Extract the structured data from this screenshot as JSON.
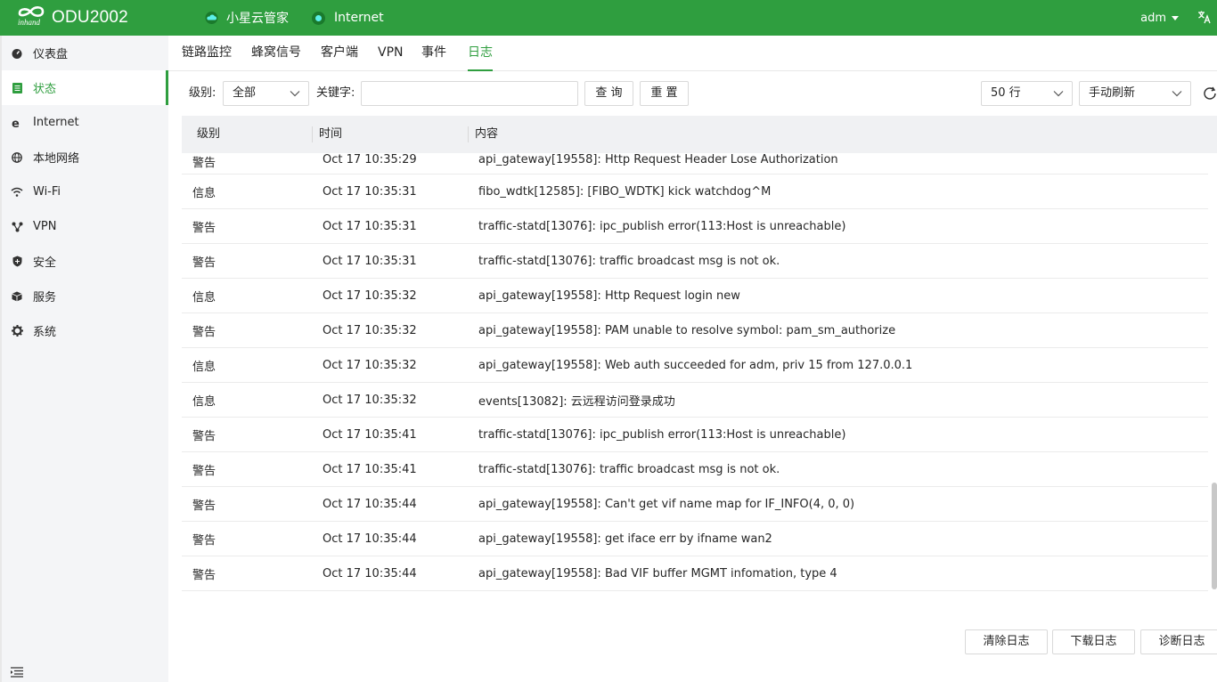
{
  "header": {
    "logo_text": "inhand",
    "model": "ODU2002",
    "cloud_label": "小星云管家",
    "internet_label": "Internet",
    "user": "adm",
    "lang_glyph": "文A"
  },
  "sidebar": {
    "items": [
      {
        "label": "仪表盘",
        "icon": "dashboard-icon"
      },
      {
        "label": "状态",
        "icon": "status-icon"
      },
      {
        "label": "Internet",
        "icon": "internet-icon"
      },
      {
        "label": "本地网络",
        "icon": "globe-icon"
      },
      {
        "label": "Wi-Fi",
        "icon": "wifi-icon"
      },
      {
        "label": "VPN",
        "icon": "vpn-icon"
      },
      {
        "label": "安全",
        "icon": "shield-icon"
      },
      {
        "label": "服务",
        "icon": "cube-icon"
      },
      {
        "label": "系统",
        "icon": "gear-icon"
      }
    ],
    "active_index": 1
  },
  "tabs": [
    {
      "label": "链路监控"
    },
    {
      "label": "蜂窝信号"
    },
    {
      "label": "客户端"
    },
    {
      "label": "VPN"
    },
    {
      "label": "事件"
    },
    {
      "label": "日志"
    }
  ],
  "active_tab": 5,
  "toolbar": {
    "level_label": "级别:",
    "level_value": "全部",
    "keyword_label": "关键字:",
    "keyword_value": "",
    "query_btn": "查 询",
    "reset_btn": "重 置",
    "rows_value": "50 行",
    "refresh_mode": "手动刷新"
  },
  "table": {
    "columns": [
      "级别",
      "时间",
      "内容"
    ],
    "rows": [
      {
        "level": "警告",
        "time": "Oct 17 10:35:29",
        "content": "api_gateway[19558]: Http Request Header Lose Authorization"
      },
      {
        "level": "信息",
        "time": "Oct 17 10:35:31",
        "content": "fibo_wdtk[12585]: [FIBO_WDTK] kick watchdog^M"
      },
      {
        "level": "警告",
        "time": "Oct 17 10:35:31",
        "content": "traffic-statd[13076]: ipc_publish error(113:Host is unreachable)"
      },
      {
        "level": "警告",
        "time": "Oct 17 10:35:31",
        "content": "traffic-statd[13076]: traffic broadcast msg is not ok."
      },
      {
        "level": "信息",
        "time": "Oct 17 10:35:32",
        "content": "api_gateway[19558]: Http Request login new"
      },
      {
        "level": "警告",
        "time": "Oct 17 10:35:32",
        "content": "api_gateway[19558]: PAM unable to resolve symbol: pam_sm_authorize"
      },
      {
        "level": "信息",
        "time": "Oct 17 10:35:32",
        "content": "api_gateway[19558]: Web auth succeeded for adm, priv 15 from 127.0.0.1"
      },
      {
        "level": "信息",
        "time": "Oct 17 10:35:32",
        "content": "events[13082]: 云远程访问登录成功"
      },
      {
        "level": "警告",
        "time": "Oct 17 10:35:41",
        "content": "traffic-statd[13076]: ipc_publish error(113:Host is unreachable)"
      },
      {
        "level": "警告",
        "time": "Oct 17 10:35:41",
        "content": "traffic-statd[13076]: traffic broadcast msg is not ok."
      },
      {
        "level": "警告",
        "time": "Oct 17 10:35:44",
        "content": "api_gateway[19558]: Can't get vif name map for IF_INFO(4, 0, 0)"
      },
      {
        "level": "警告",
        "time": "Oct 17 10:35:44",
        "content": "api_gateway[19558]: get iface err by ifname wan2"
      },
      {
        "level": "警告",
        "time": "Oct 17 10:35:44",
        "content": "api_gateway[19558]: Bad VIF buffer MGMT infomation, type 4"
      }
    ]
  },
  "actions": {
    "clear": "清除日志",
    "download": "下载日志",
    "diagnose": "诊断日志"
  },
  "colors": {
    "brand": "#2f9e3f",
    "sidebar_bg": "#f4f5f7",
    "header_row_bg": "#f0f1f3"
  }
}
